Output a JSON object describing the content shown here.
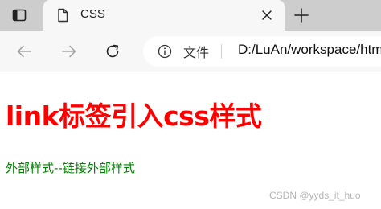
{
  "browser": {
    "tab": {
      "title": "CSS",
      "favicon": "page-icon",
      "close_icon": "close-icon"
    },
    "new_tab_icon": "plus-icon",
    "tab_actions_icon": "tab-actions-icon",
    "toolbar": {
      "back_icon": "arrow-left-icon",
      "forward_icon": "arrow-right-icon",
      "reload_icon": "reload-icon"
    },
    "address_bar": {
      "info_icon": "info-icon",
      "scheme_label": "文件",
      "url": "D:/LuAn/workspace/htm"
    }
  },
  "page": {
    "heading": "link标签引入css样式",
    "paragraph": "外部样式--链接外部样式"
  },
  "watermark": "CSDN @yyds_it_huo",
  "colors": {
    "heading": "#ff0000",
    "paragraph": "#008000",
    "tabstrip": "#cdcdcd",
    "toolbar": "#f7f7f7"
  }
}
